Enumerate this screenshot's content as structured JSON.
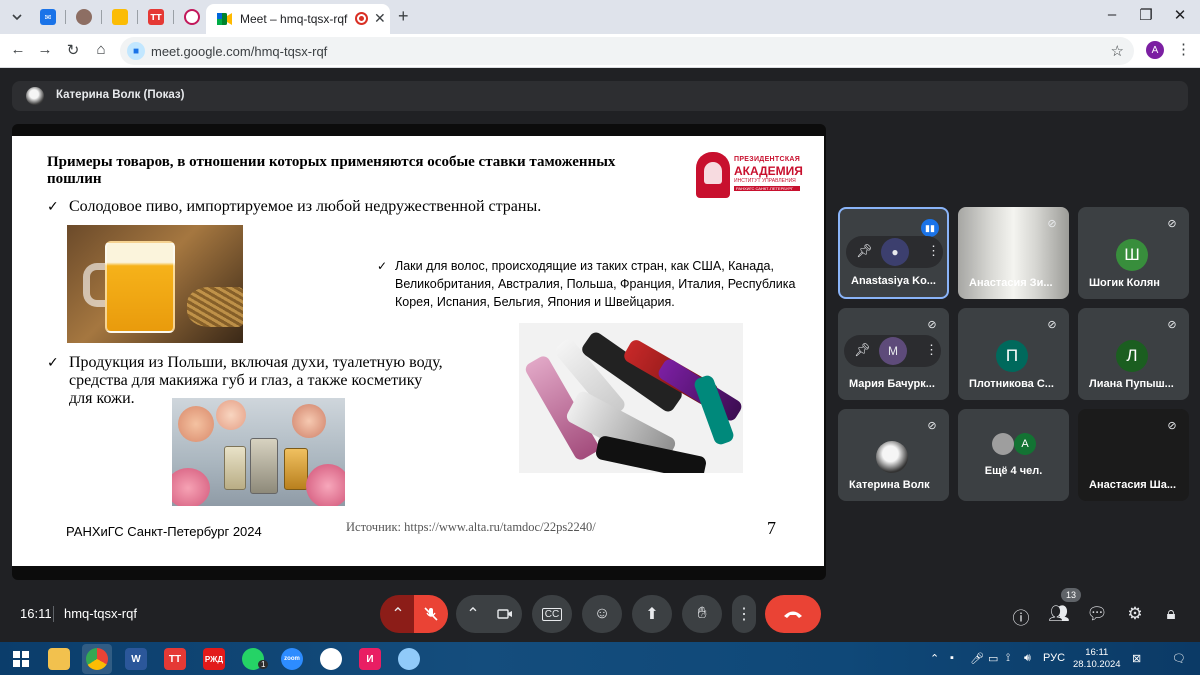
{
  "browser": {
    "active_tab_title": "Meet – hmq-tqsx-rqf",
    "url": "meet.google.com/hmq-tqsx-rqf",
    "profile_initial": "A",
    "new_tab_symbol": "+",
    "tab_close_symbol": "✕"
  },
  "presenter": {
    "label": "Катерина Волк (Показ)"
  },
  "slide": {
    "title": "Примеры товаров, в отношении которых применяются особые ставки таможенных пошлин",
    "item1": "Солодовое пиво, импортируемое из любой недружественной страны.",
    "item2": "Лаки для волос, происходящие из таких стран, как США, Канада, Великобритания, Австралия, Польша, Франция, Италия, Республика Корея, Испания, Бельгия, Япония и Швейцария.",
    "item3": "Продукция из Польши, включая духи, туалетную воду, средства для макияжа губ и глаз, а также косметику для кожи.",
    "checkmark": "✓",
    "footer_left": "РАНХиГС Санкт-Петербург  2024",
    "source": "Источник: https://www.alta.ru/tamdoc/22ps2240/",
    "page_number": "7",
    "logo": {
      "line1": "ПРЕЗИДЕНТСКАЯ",
      "line2": "АКАДЕМИЯ",
      "line3": "ИНСТИТУТ УПРАВЛЕНИЯ",
      "line4": "РАНХИГС  САНКТ-ПЕТЕРБУРГ"
    }
  },
  "participants": [
    {
      "name": "Anastasiya Ko...",
      "state": "speaking-hover"
    },
    {
      "name": "Анастасия Зи...",
      "state": "muted",
      "has_video": true
    },
    {
      "name": "Шогик Колян",
      "initial": "Ш",
      "color": "#2e7d32",
      "state": "muted"
    },
    {
      "name": "Мария Бачурк...",
      "initial": "М",
      "state": "hover-muted"
    },
    {
      "name": "Плотникова С...",
      "initial": "П",
      "color": "#00695c",
      "state": "muted"
    },
    {
      "name": "Лиана Пупыш...",
      "initial": "Л",
      "color": "#1b5e20",
      "state": "muted"
    },
    {
      "name": "Катерина Волк",
      "state": "muted"
    },
    {
      "name": "Ещё 4 чел.",
      "initial": "А",
      "color": "#137333"
    },
    {
      "name": "Анастасия Ша...",
      "state": "muted",
      "has_video": true
    }
  ],
  "meet_bar": {
    "time": "16:11",
    "meeting_code": "hmq-tqsx-rqf",
    "participant_count": "13"
  },
  "taskbar": {
    "language": "РУС",
    "time": "16:11",
    "date": "28.10.2024",
    "whatsapp_badge": "1"
  },
  "colors": {
    "meet_bg": "#202124",
    "end_call": "#ea4335",
    "accent_blue": "#1a73e8",
    "logo_red": "#c8102e"
  }
}
